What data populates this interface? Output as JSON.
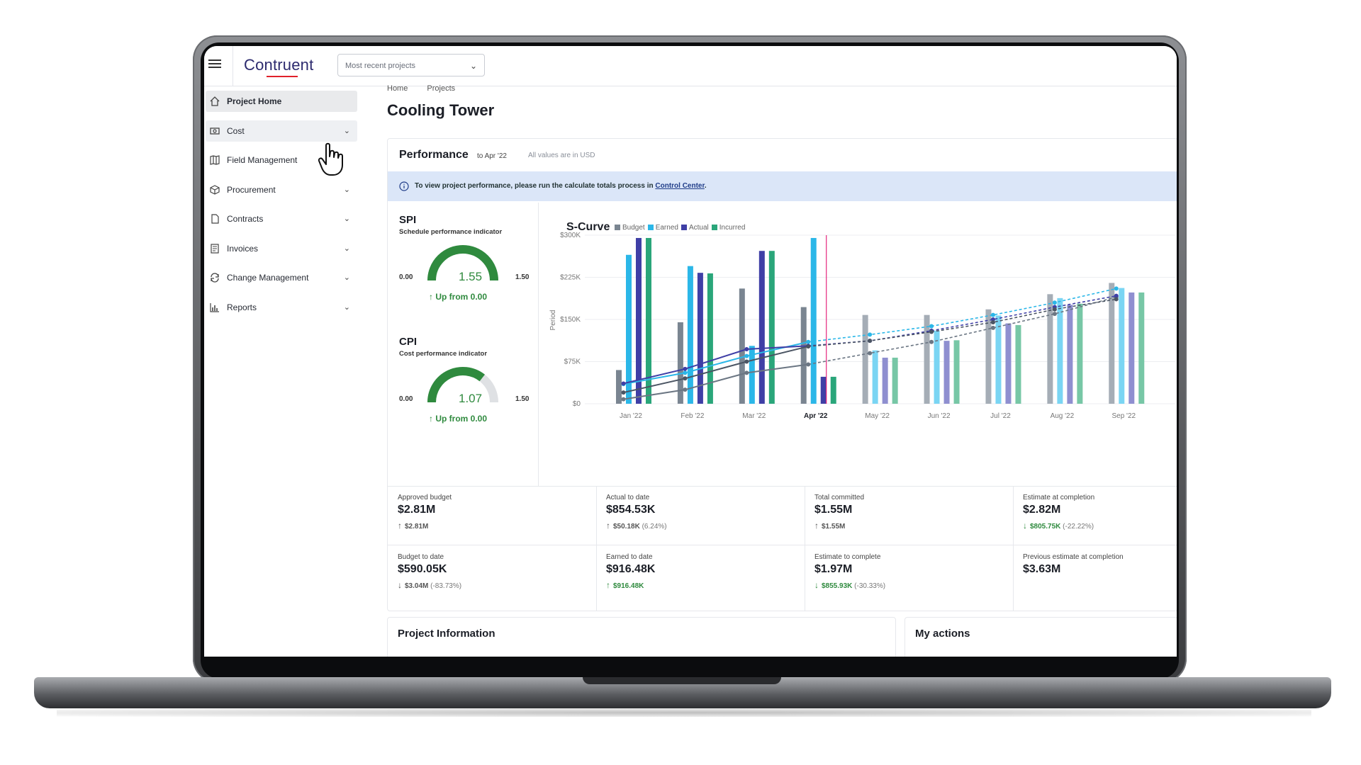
{
  "app": {
    "logo": "Contruent",
    "project_select": "Most recent projects",
    "brand_accent": "#e0202a",
    "brand_color": "#2c2a6e"
  },
  "sidebar": {
    "items": [
      {
        "label": "Project Home",
        "icon": "home-icon",
        "active": true,
        "chevron": false
      },
      {
        "label": "Cost",
        "icon": "cost-icon",
        "chevron": true
      },
      {
        "label": "Field Management",
        "icon": "map-icon",
        "chevron": false
      },
      {
        "label": "Procurement",
        "icon": "box-icon",
        "chevron": true
      },
      {
        "label": "Contracts",
        "icon": "document-icon",
        "chevron": true
      },
      {
        "label": "Invoices",
        "icon": "invoice-icon",
        "chevron": true
      },
      {
        "label": "Change Management",
        "icon": "refresh-icon",
        "chevron": true
      },
      {
        "label": "Reports",
        "icon": "chart-icon",
        "chevron": true
      }
    ]
  },
  "breadcrumb": [
    "Home",
    "Projects"
  ],
  "page_title": "Cooling Tower",
  "performance": {
    "title": "Performance",
    "to": "to Apr '22",
    "note": "All values are in USD",
    "banner_text": "To view project performance, please run the calculate totals process in",
    "banner_link": "Control Center",
    "banner_end": "."
  },
  "spi": {
    "title": "SPI",
    "subtitle": "Schedule performance indicator",
    "min": "0.00",
    "max": "1.50",
    "value": "1.55",
    "fill": 1.0,
    "trend": "Up from 0.00"
  },
  "cpi": {
    "title": "CPI",
    "subtitle": "Cost performance indicator",
    "min": "0.00",
    "max": "1.50",
    "value": "1.07",
    "fill": 0.713,
    "trend": "Up from 0.00"
  },
  "chart_data": {
    "type": "bar",
    "title": "S-Curve",
    "ylabel": "Period",
    "yticks": [
      "$0",
      "$75K",
      "$150K",
      "$225K",
      "$300K"
    ],
    "ylim": [
      0,
      300000
    ],
    "categories": [
      "Jan '22",
      "Feb '22",
      "Mar '22",
      "Apr '22",
      "May '22",
      "Jun '22",
      "Jul '22",
      "Aug '22",
      "Sep '22"
    ],
    "current_period": "Apr '22",
    "colors": {
      "Budget": "#7a8591",
      "Earned": "#2bb7e8",
      "Actual": "#3f3fa6",
      "Incurred": "#2aa67a"
    },
    "series": [
      {
        "name": "Budget",
        "values": [
          60000,
          145000,
          205000,
          172000,
          158000,
          158000,
          168000,
          195000,
          215000
        ]
      },
      {
        "name": "Earned",
        "values": [
          265000,
          245000,
          103000,
          295000,
          95000,
          130000,
          157000,
          188000,
          206000
        ]
      },
      {
        "name": "Actual",
        "values": [
          295000,
          233000,
          272000,
          48000,
          82000,
          112000,
          143000,
          176000,
          198000
        ]
      },
      {
        "name": "Incurred",
        "values": [
          295000,
          232000,
          272000,
          48000,
          82000,
          113000,
          140000,
          178000,
          198000
        ]
      }
    ],
    "cumulative": {
      "Budget": [
        8000,
        25000,
        55000,
        70000,
        90000,
        110000,
        135000,
        160000,
        190000
      ],
      "Earned": [
        35000,
        55000,
        85000,
        110000,
        123000,
        138000,
        158000,
        180000,
        205000
      ],
      "Actual": [
        36000,
        62000,
        97000,
        103000,
        112000,
        130000,
        150000,
        172000,
        192000
      ],
      "Incurred": [
        20000,
        45000,
        75000,
        102000,
        112000,
        128000,
        145000,
        168000,
        186000
      ]
    },
    "legend": "top"
  },
  "kpis": [
    {
      "label": "Approved budget",
      "value": "$2.81M",
      "delta": "$2.81M",
      "pct": "",
      "dir": "up",
      "green": false
    },
    {
      "label": "Actual to date",
      "value": "$854.53K",
      "delta": "$50.18K",
      "pct": "(6.24%)",
      "dir": "up",
      "green": false
    },
    {
      "label": "Total committed",
      "value": "$1.55M",
      "delta": "$1.55M",
      "pct": "",
      "dir": "up",
      "green": false
    },
    {
      "label": "Estimate at completion",
      "value": "$2.82M",
      "delta": "$805.75K",
      "pct": "(-22.22%)",
      "dir": "down",
      "green": true
    },
    {
      "label": "Budget to date",
      "value": "$590.05K",
      "delta": "$3.04M",
      "pct": "(-83.73%)",
      "dir": "down",
      "green": false
    },
    {
      "label": "Earned to date",
      "value": "$916.48K",
      "delta": "$916.48K",
      "pct": "",
      "dir": "up",
      "green": true
    },
    {
      "label": "Estimate to complete",
      "value": "$1.97M",
      "delta": "$855.93K",
      "pct": "(-30.33%)",
      "dir": "down",
      "green": true
    },
    {
      "label": "Previous estimate at completion",
      "value": "$3.63M",
      "delta": "",
      "pct": "",
      "dir": "",
      "green": false
    }
  ],
  "cards": {
    "project_info": "Project Information",
    "my_actions": "My actions"
  }
}
